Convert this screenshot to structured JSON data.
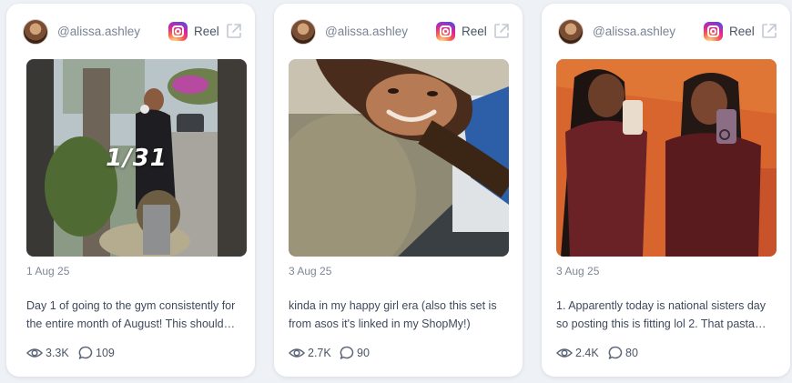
{
  "posts": [
    {
      "handle": "@alissa.ashley",
      "platform_icon": "instagram-icon",
      "type_label": "Reel",
      "slide_counter": "1/31",
      "date": "1 Aug 25",
      "caption_lines": [
        "Day 1 of going to the gym consistently for",
        "the entire month of August! This should…"
      ],
      "views": "3.3K",
      "comments": "109"
    },
    {
      "handle": "@alissa.ashley",
      "platform_icon": "instagram-icon",
      "type_label": "Reel",
      "date": "3 Aug 25",
      "caption_lines": [
        "kinda in my happy girl era (also this set is",
        "from asos it's linked in my ShopMy!)"
      ],
      "views": "2.7K",
      "comments": "90"
    },
    {
      "handle": "@alissa.ashley",
      "platform_icon": "instagram-icon",
      "type_label": "Reel",
      "date": "3 Aug 25",
      "caption_lines": [
        "1. Apparently today is national sisters day",
        "so posting this is fitting lol 2. That pasta…"
      ],
      "views": "2.4K",
      "comments": "80"
    }
  ],
  "colors": {
    "page_bg": "#eef1f5",
    "card_bg": "#ffffff",
    "muted_text": "#7d8796",
    "body_text": "#3f4a5c"
  }
}
